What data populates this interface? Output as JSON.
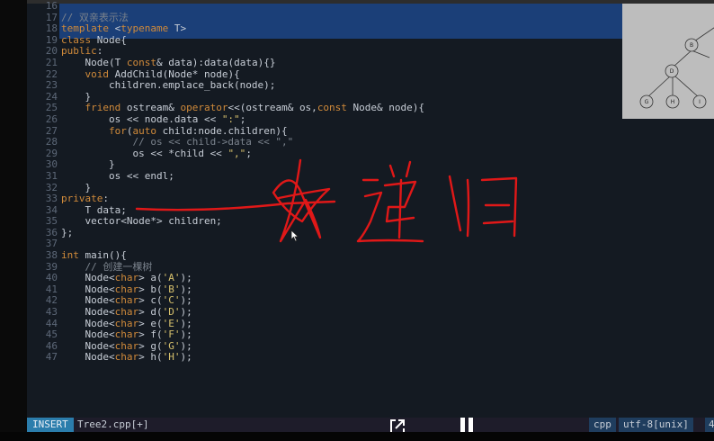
{
  "code": {
    "lines": [
      {
        "n": "16",
        "parts": []
      },
      {
        "n": "17",
        "parts": [
          {
            "c": "cm",
            "t": "// 双亲表示法"
          }
        ]
      },
      {
        "n": "18",
        "parts": [
          {
            "c": "kw",
            "t": "template"
          },
          {
            "c": "tx",
            "t": " <"
          },
          {
            "c": "kw",
            "t": "typename"
          },
          {
            "c": "tx",
            "t": " T>"
          }
        ]
      },
      {
        "n": "19",
        "parts": [
          {
            "c": "kw",
            "t": "class"
          },
          {
            "c": "tx",
            "t": " Node{"
          }
        ]
      },
      {
        "n": "20",
        "parts": [
          {
            "c": "kw",
            "t": "public"
          },
          {
            "c": "tx",
            "t": ":"
          }
        ]
      },
      {
        "n": "21",
        "parts": [
          {
            "c": "tx",
            "t": "    Node(T "
          },
          {
            "c": "kw",
            "t": "const"
          },
          {
            "c": "tx",
            "t": "& data):data(data){}"
          }
        ]
      },
      {
        "n": "22",
        "parts": [
          {
            "c": "tx",
            "t": "    "
          },
          {
            "c": "ty",
            "t": "void"
          },
          {
            "c": "tx",
            "t": " AddChild(Node* node){"
          }
        ]
      },
      {
        "n": "23",
        "parts": [
          {
            "c": "tx",
            "t": "        children.emplace_back(node);"
          }
        ]
      },
      {
        "n": "24",
        "parts": [
          {
            "c": "tx",
            "t": "    }"
          }
        ]
      },
      {
        "n": "25",
        "parts": [
          {
            "c": "tx",
            "t": "    "
          },
          {
            "c": "kw",
            "t": "friend"
          },
          {
            "c": "tx",
            "t": " ostream& "
          },
          {
            "c": "kw",
            "t": "operator"
          },
          {
            "c": "tx",
            "t": "<<(ostream& os,"
          },
          {
            "c": "kw",
            "t": "const"
          },
          {
            "c": "tx",
            "t": " Node& node){"
          }
        ]
      },
      {
        "n": "26",
        "parts": [
          {
            "c": "tx",
            "t": "        os << node.data << "
          },
          {
            "c": "str",
            "t": "\":\""
          },
          {
            "c": "tx",
            "t": ";"
          }
        ]
      },
      {
        "n": "27",
        "parts": [
          {
            "c": "tx",
            "t": "        "
          },
          {
            "c": "kw",
            "t": "for"
          },
          {
            "c": "tx",
            "t": "("
          },
          {
            "c": "kw",
            "t": "auto"
          },
          {
            "c": "tx",
            "t": " child:node.children){"
          }
        ]
      },
      {
        "n": "28",
        "parts": [
          {
            "c": "cm",
            "t": "            // os << child->data << \",\""
          }
        ]
      },
      {
        "n": "29",
        "parts": [
          {
            "c": "tx",
            "t": "            os << *child << "
          },
          {
            "c": "str",
            "t": "\",\""
          },
          {
            "c": "tx",
            "t": ";"
          }
        ]
      },
      {
        "n": "30",
        "parts": [
          {
            "c": "tx",
            "t": "        }"
          }
        ]
      },
      {
        "n": "31",
        "parts": [
          {
            "c": "tx",
            "t": "        os << endl;"
          }
        ]
      },
      {
        "n": "32",
        "parts": [
          {
            "c": "tx",
            "t": "    }"
          }
        ]
      },
      {
        "n": "33",
        "parts": [
          {
            "c": "kw",
            "t": "private"
          },
          {
            "c": "tx",
            "t": ":"
          }
        ]
      },
      {
        "n": "34",
        "parts": [
          {
            "c": "tx",
            "t": "    T data;"
          }
        ]
      },
      {
        "n": "35",
        "parts": [
          {
            "c": "tx",
            "t": "    vector<Node*> children;"
          }
        ]
      },
      {
        "n": "36",
        "parts": [
          {
            "c": "tx",
            "t": "};"
          }
        ]
      },
      {
        "n": "37",
        "parts": []
      },
      {
        "n": "38",
        "parts": [
          {
            "c": "ty",
            "t": "int"
          },
          {
            "c": "tx",
            "t": " main(){"
          }
        ]
      },
      {
        "n": "39",
        "parts": [
          {
            "c": "cm",
            "t": "    // 创建一棵树"
          }
        ]
      },
      {
        "n": "40",
        "parts": [
          {
            "c": "tx",
            "t": "    Node<"
          },
          {
            "c": "ty",
            "t": "char"
          },
          {
            "c": "tx",
            "t": "> a("
          },
          {
            "c": "str",
            "t": "'A'"
          },
          {
            "c": "tx",
            "t": ");"
          }
        ]
      },
      {
        "n": "41",
        "parts": [
          {
            "c": "tx",
            "t": "    Node<"
          },
          {
            "c": "ty",
            "t": "char"
          },
          {
            "c": "tx",
            "t": "> b("
          },
          {
            "c": "str",
            "t": "'B'"
          },
          {
            "c": "tx",
            "t": ");"
          }
        ]
      },
      {
        "n": "42",
        "parts": [
          {
            "c": "tx",
            "t": "    Node<"
          },
          {
            "c": "ty",
            "t": "char"
          },
          {
            "c": "tx",
            "t": "> c("
          },
          {
            "c": "str",
            "t": "'C'"
          },
          {
            "c": "tx",
            "t": ");"
          }
        ]
      },
      {
        "n": "43",
        "parts": [
          {
            "c": "tx",
            "t": "    Node<"
          },
          {
            "c": "ty",
            "t": "char"
          },
          {
            "c": "tx",
            "t": "> d("
          },
          {
            "c": "str",
            "t": "'D'"
          },
          {
            "c": "tx",
            "t": ");"
          }
        ]
      },
      {
        "n": "44",
        "parts": [
          {
            "c": "tx",
            "t": "    Node<"
          },
          {
            "c": "ty",
            "t": "char"
          },
          {
            "c": "tx",
            "t": "> e("
          },
          {
            "c": "str",
            "t": "'E'"
          },
          {
            "c": "tx",
            "t": ");"
          }
        ]
      },
      {
        "n": "45",
        "parts": [
          {
            "c": "tx",
            "t": "    Node<"
          },
          {
            "c": "ty",
            "t": "char"
          },
          {
            "c": "tx",
            "t": "> f("
          },
          {
            "c": "str",
            "t": "'F'"
          },
          {
            "c": "tx",
            "t": ");"
          }
        ]
      },
      {
        "n": "46",
        "parts": [
          {
            "c": "tx",
            "t": "    Node<"
          },
          {
            "c": "ty",
            "t": "char"
          },
          {
            "c": "tx",
            "t": "> g("
          },
          {
            "c": "str",
            "t": "'G'"
          },
          {
            "c": "tx",
            "t": ");"
          }
        ]
      },
      {
        "n": "47",
        "parts": [
          {
            "c": "tx",
            "t": "    Node<"
          },
          {
            "c": "ty",
            "t": "char"
          },
          {
            "c": "tx",
            "t": "> h("
          },
          {
            "c": "str",
            "t": "'H'"
          },
          {
            "c": "tx",
            "t": ");"
          }
        ]
      }
    ]
  },
  "tree_diagram": {
    "nodes": [
      "A",
      "B",
      "D",
      "E",
      "G",
      "H",
      "I"
    ]
  },
  "annotation": {
    "handwritten_text": "递归",
    "ink_color": "#e01818"
  },
  "statusbar": {
    "mode": "INSERT",
    "filename": "Tree2.cpp[+]",
    "filetype": "cpp",
    "encoding": "utf-8[unix]",
    "position": "4"
  },
  "player": {
    "popout_icon": "popout-icon",
    "pause_icon": "pause-icon"
  },
  "colors": {
    "editor_bg": "#141a22",
    "selection": "#1b3f78",
    "keyword": "#d08a3a",
    "string": "#d6c06c",
    "comment": "#7a828c",
    "mode_bg": "#2b7dac"
  }
}
